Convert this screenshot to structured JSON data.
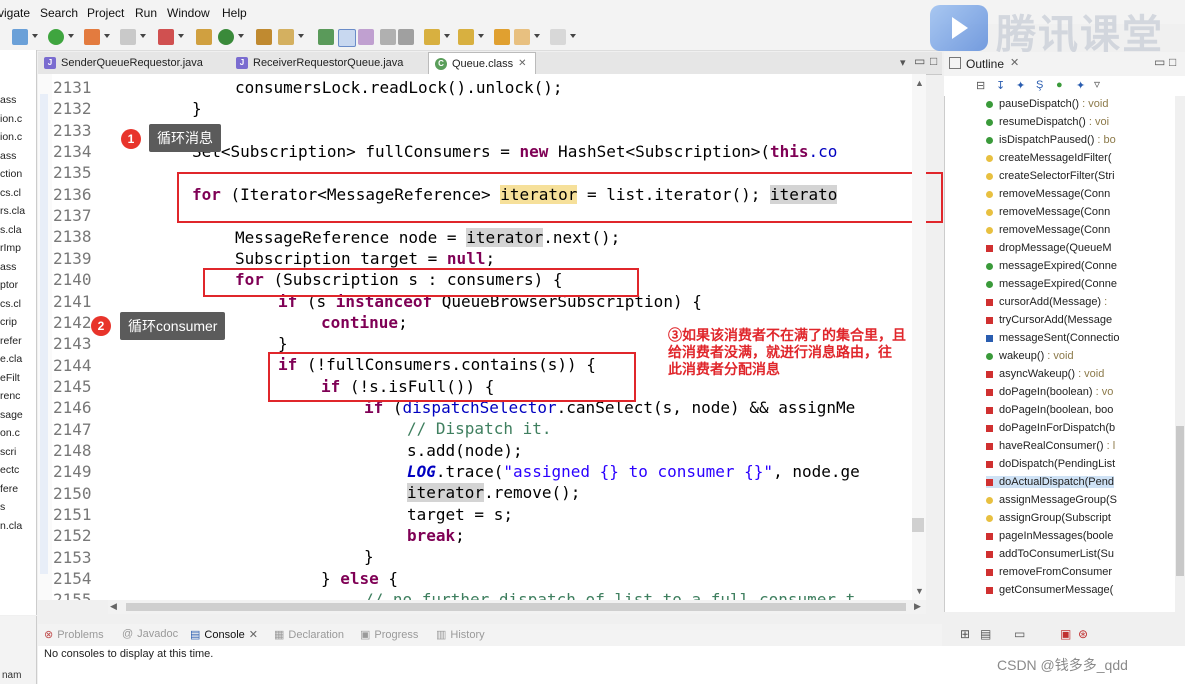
{
  "menu": [
    "vigate",
    "Search",
    "Project",
    "Run",
    "Window",
    "Help"
  ],
  "watermark": {
    "text": "腾讯课堂"
  },
  "left_strip": [
    "ass",
    "ion.c",
    "ion.c",
    "ass",
    "ction",
    "cs.cl",
    "rs.cla",
    "s.cla",
    "rImp",
    "ass",
    "ptor",
    "cs.cl",
    "crip",
    "refer",
    "e.cla",
    "eFilt",
    "renc",
    "sage",
    "on.c",
    "scri",
    "ectc",
    "fere",
    "s",
    "n.cla"
  ],
  "editor_tabs": [
    {
      "label": "SenderQueueRequestor.java",
      "icon": "java-file-icon"
    },
    {
      "label": "ReceiverRequestorQueue.java",
      "icon": "java-file-icon"
    },
    {
      "label": "Queue.class",
      "icon": "class-file-icon",
      "active": true
    }
  ],
  "code": {
    "line_numbers": [
      "2131",
      "2132",
      "2133",
      "2134",
      "2135",
      "2136",
      "2137",
      "2138",
      "2139",
      "2140",
      "2141",
      "2142",
      "2143",
      "2144",
      "2145",
      "2146",
      "2147",
      "2148",
      "2149",
      "2150",
      "2151",
      "2152",
      "2153",
      "2154",
      "2155"
    ],
    "l2131": "consumersLock.readLock().unlock();",
    "l2132": "}",
    "l2134_a": "Set<Subscription> fullConsumers = ",
    "l2134_kw": "new",
    "l2134_b": " HashSet<Subscription>(",
    "l2134_kw2": "this",
    "l2134_c": ".co",
    "l2136_kw": "for",
    "l2136_a": " (Iterator<MessageReference> ",
    "l2136_iter": "iterator",
    "l2136_b": " = list.iterator(); ",
    "l2136_iter2": "iterato",
    "l2138_a": "MessageReference node = ",
    "l2138_iter": "iterator",
    "l2138_b": ".next();",
    "l2139_a": "Subscription target = ",
    "l2139_kw": "null",
    "l2139_b": ";",
    "l2140_kw": "for",
    "l2140_a": " (Subscription s : consumers) {",
    "l2141_kw": "if",
    "l2141_a": " (s ",
    "l2141_kw2": "instanceof",
    "l2141_b": " QueueBrowserSubscription) {",
    "l2142_kw": "continue",
    "l2142_a": ";",
    "l2143": "}",
    "l2144_kw": "if",
    "l2144_a": " (!fullConsumers.contains(s)) {",
    "l2145_kw": "if",
    "l2145_a": " (!s.isFull()) {",
    "l2146_kw": "if",
    "l2146_a": " (",
    "l2146_fld": "dispatchSelector",
    "l2146_b": ".canSelect(s, node) && assignMe",
    "l2147": "// Dispatch it.",
    "l2148": "s.add(node);",
    "l2149_log": "LOG",
    "l2149_a": ".trace(",
    "l2149_str": "\"assigned {} to consumer {}\"",
    "l2149_b": ", node.ge",
    "l2150_iter": "iterator",
    "l2150_a": ".remove();",
    "l2151": "target = s;",
    "l2152_kw": "break",
    "l2152_a": ";",
    "l2153": "}",
    "l2154_a": "} ",
    "l2154_kw": "else",
    "l2154_b": " {",
    "l2155": "// no further dispatch of list to a full consumer t"
  },
  "annotations": {
    "badge1": "1",
    "callout1": "循环消息",
    "badge2": "2",
    "callout2": "循环consumer",
    "note3": "③如果该消费者不在满了的集合里，且\n给消费者没满，就进行消息路由，往\n此消费者分配消息"
  },
  "outline": {
    "title": "Outline",
    "items": [
      {
        "name": "pauseDispatch()",
        "type": " : void",
        "color": "#3a9a3a",
        "shape": "dot"
      },
      {
        "name": "resumeDispatch()",
        "type": " : voi",
        "color": "#3a9a3a",
        "shape": "dot"
      },
      {
        "name": "isDispatchPaused()",
        "type": " : bo",
        "color": "#3a9a3a",
        "shape": "dot"
      },
      {
        "name": "createMessageIdFilter(",
        "type": "",
        "color": "#e8c040",
        "shape": "dot"
      },
      {
        "name": "createSelectorFilter(Stri",
        "type": "",
        "color": "#e8c040",
        "shape": "dot"
      },
      {
        "name": "removeMessage(Conn",
        "type": "",
        "color": "#e8c040",
        "shape": "dot"
      },
      {
        "name": "removeMessage(Conn",
        "type": "",
        "color": "#e8c040",
        "shape": "dot"
      },
      {
        "name": "removeMessage(Conn",
        "type": "",
        "color": "#e8c040",
        "shape": "dot"
      },
      {
        "name": "dropMessage(QueueM",
        "type": "",
        "color": "#d03030",
        "shape": "sq"
      },
      {
        "name": "messageExpired(Conne",
        "type": "",
        "color": "#3a9a3a",
        "shape": "dot"
      },
      {
        "name": "messageExpired(Conne",
        "type": "",
        "color": "#3a9a3a",
        "shape": "dot"
      },
      {
        "name": "cursorAdd(Message)",
        "type": " :",
        "color": "#d03030",
        "shape": "sq"
      },
      {
        "name": "tryCursorAdd(Message",
        "type": "",
        "color": "#d03030",
        "shape": "sq"
      },
      {
        "name": "messageSent(Connectio",
        "type": "",
        "color": "#2a5db0",
        "shape": "sq"
      },
      {
        "name": "wakeup()",
        "type": " : void",
        "color": "#3a9a3a",
        "shape": "dot"
      },
      {
        "name": "asyncWakeup()",
        "type": " : void",
        "color": "#d03030",
        "shape": "sq"
      },
      {
        "name": "doPageIn(boolean)",
        "type": " : vo",
        "color": "#d03030",
        "shape": "sq"
      },
      {
        "name": "doPageIn(boolean, boo",
        "type": "",
        "color": "#d03030",
        "shape": "sq"
      },
      {
        "name": "doPageInForDispatch(b",
        "type": "",
        "color": "#d03030",
        "shape": "sq"
      },
      {
        "name": "haveRealConsumer()",
        "type": " : l",
        "color": "#d03030",
        "shape": "sq"
      },
      {
        "name": "doDispatch(PendingList",
        "type": "",
        "color": "#d03030",
        "shape": "sq"
      },
      {
        "name": "doActualDispatch(Pend",
        "type": "",
        "color": "#d03030",
        "shape": "sq",
        "selected": true
      },
      {
        "name": "assignMessageGroup(S",
        "type": "",
        "color": "#e8c040",
        "shape": "dot"
      },
      {
        "name": "assignGroup(Subscript",
        "type": "",
        "color": "#e8c040",
        "shape": "dot"
      },
      {
        "name": "pageInMessages(boole",
        "type": "",
        "color": "#d03030",
        "shape": "sq"
      },
      {
        "name": "addToConsumerList(Su",
        "type": "",
        "color": "#d03030",
        "shape": "sq"
      },
      {
        "name": "removeFromConsumer",
        "type": "",
        "color": "#d03030",
        "shape": "sq"
      },
      {
        "name": "getConsumerMessage(",
        "type": "",
        "color": "#d03030",
        "shape": "sq"
      }
    ]
  },
  "console": {
    "tabs": [
      {
        "label": "Problems",
        "icon": "problems-icon"
      },
      {
        "label": "Javadoc",
        "icon": "javadoc-icon"
      },
      {
        "label": "Console",
        "icon": "console-icon",
        "active": true
      },
      {
        "label": "Declaration",
        "icon": "declaration-icon"
      },
      {
        "label": "Progress",
        "icon": "progress-icon"
      },
      {
        "label": "History",
        "icon": "history-icon"
      }
    ],
    "message": "No consoles to display at this time.",
    "left_fragment": "nam"
  },
  "footer_watermark": "CSDN @钱多多_qdd",
  "colors": {
    "highlight_box": "#e0262b",
    "keyword": "#7f0055",
    "string": "#2a00ff",
    "selection": "#cfe2f5"
  }
}
